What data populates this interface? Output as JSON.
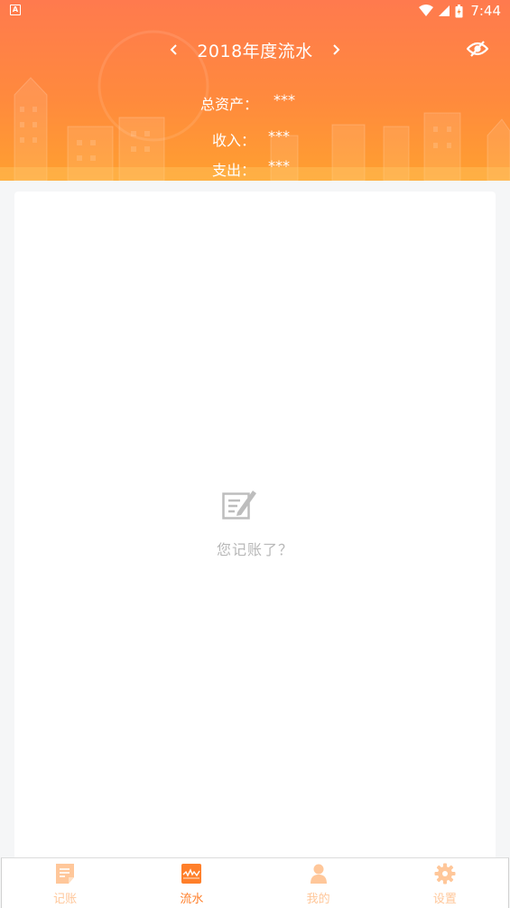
{
  "statusbar": {
    "time": "7:44",
    "left_icon_letter": "A"
  },
  "header": {
    "title": "2018年度流水",
    "prev_icon": "chevron-left-icon",
    "next_icon": "chevron-right-icon",
    "visibility_icon": "eye-off-icon"
  },
  "summary": {
    "total_assets_label": "总资产：",
    "total_assets_value": "***",
    "income_label": "收入：",
    "income_value": "***",
    "expense_label": "支出：",
    "expense_value": "***"
  },
  "empty_state": {
    "icon": "edit-note-icon",
    "text": "您记账了？"
  },
  "tabs": [
    {
      "label": "记账",
      "icon": "note-icon",
      "active": false
    },
    {
      "label": "流水",
      "icon": "wave-chart-icon",
      "active": true
    },
    {
      "label": "我的",
      "icon": "user-icon",
      "active": false
    },
    {
      "label": "设置",
      "icon": "gear-icon",
      "active": false
    }
  ],
  "colors": {
    "accent": "#ff7f2a",
    "header_top": "#ff7a4e",
    "header_bottom": "#ffa030",
    "inactive_tab": "#ffc79a"
  }
}
